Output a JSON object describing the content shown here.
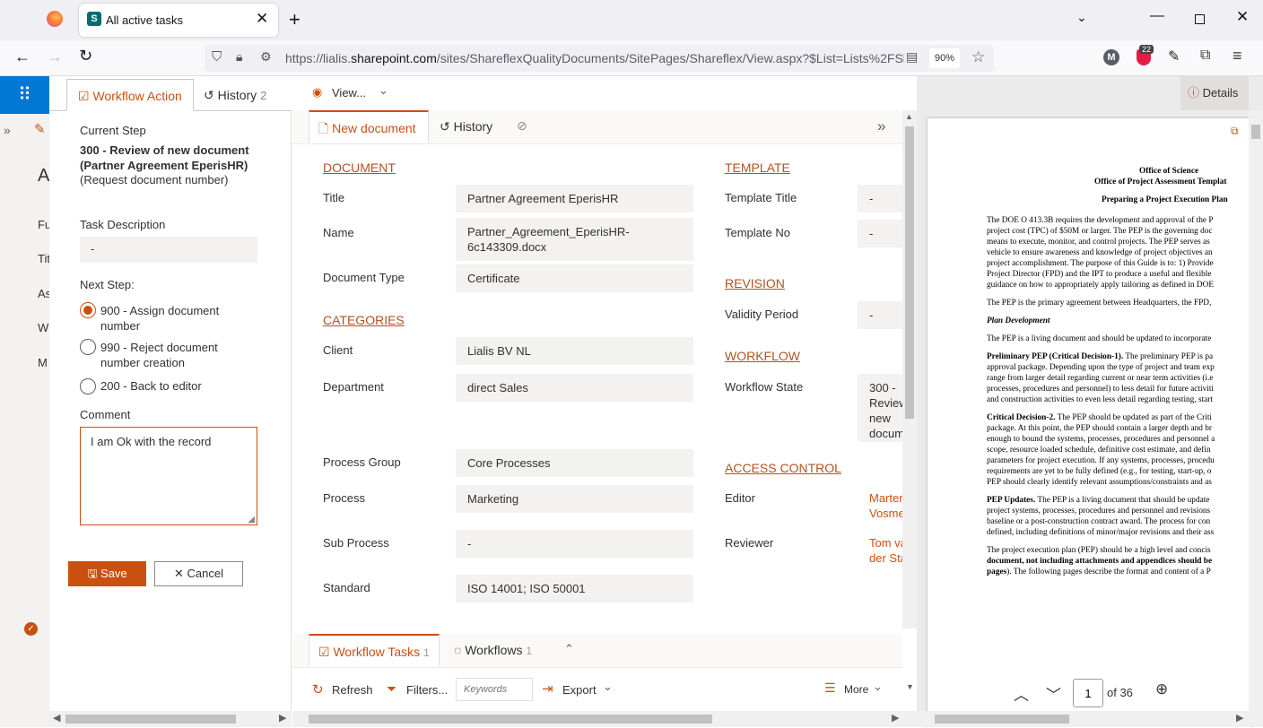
{
  "browser": {
    "tab_title": "All active tasks",
    "url_prefix": "https://lialis.",
    "url_domain": "sharepoint.com",
    "url_suffix": "/sites/ShareflexQualityDocuments/SitePages/Shareflex/View.aspx?$List=Lists%2FShar",
    "zoom": "90%",
    "ext_badge": "22",
    "profile_initial": "M"
  },
  "left_nav": {
    "letters": [
      "A",
      "Fu",
      "Tit",
      "As",
      "W",
      "M"
    ]
  },
  "workflow_panel": {
    "tab_action": "Workflow Action",
    "tab_history": "History",
    "history_count": "2",
    "current_step_label": "Current Step",
    "current_step_value": "300 - Review of new document (Partner Agreement EperisHR)",
    "current_step_sub": "(Request document number)",
    "task_desc_label": "Task Description",
    "task_desc_value": "-",
    "next_step_label": "Next Step:",
    "options": [
      {
        "label": "900 - Assign document number",
        "line1": "900 - Assign document",
        "line2": "number",
        "selected": true
      },
      {
        "label": "990 - Reject document number creation",
        "line1": "990 - Reject document",
        "line2": "number creation",
        "selected": false
      },
      {
        "label": "200 - Back to editor",
        "line1": "200 - Back to editor",
        "line2": "",
        "selected": false
      }
    ],
    "comment_label": "Comment",
    "comment_value": "I am Ok with the record",
    "save_label": "Save",
    "cancel_label": "Cancel"
  },
  "main": {
    "view_label": "View...",
    "details_label": "Details",
    "tab_new_document": "New document",
    "tab_history": "History",
    "sections": {
      "document": "DOCUMENT",
      "categories": "CATEGORIES",
      "template": "TEMPLATE",
      "revision": "REVISION",
      "workflow": "WORKFLOW",
      "access_control": "ACCESS CONTROL"
    },
    "fields": {
      "title_label": "Title",
      "title_value": "Partner Agreement EperisHR",
      "name_label": "Name",
      "name_value_1": "Partner_Agreement_EperisHR-",
      "name_value_2": "6c143309.docx",
      "doctype_label": "Document Type",
      "doctype_value": "Certificate",
      "client_label": "Client",
      "client_value": "Lialis BV NL",
      "department_label": "Department",
      "department_value": "direct Sales",
      "process_group_label": "Process Group",
      "process_group_value": "Core Processes",
      "process_label": "Process",
      "process_value": "Marketing",
      "sub_process_label": "Sub Process",
      "sub_process_value": "-",
      "standard_label": "Standard",
      "standard_value": "ISO 14001; ISO 50001",
      "template_title_label": "Template Title",
      "template_title_value": "-",
      "template_no_label": "Template No",
      "template_no_value": "-",
      "validity_label": "Validity Period",
      "validity_value": "-",
      "wf_state_label": "Workflow State",
      "wf_state_lines": [
        "300 -",
        "Review",
        "new",
        "docum"
      ],
      "editor_label": "Editor",
      "editor_lines": [
        "Marten",
        "Vosme"
      ],
      "reviewer_label": "Reviewer",
      "reviewer_lines": [
        "Tom va",
        "der Sta"
      ]
    },
    "bottom_tabs": {
      "workflow_tasks": "Workflow Tasks",
      "workflow_tasks_count": "1",
      "workflows": "Workflows",
      "workflows_count": "1"
    },
    "bottom_toolbar": {
      "refresh": "Refresh",
      "filters": "Filters...",
      "keywords_placeholder": "Keywords",
      "export": "Export",
      "more": "More"
    }
  },
  "preview": {
    "page_input": "1",
    "page_total": "of 36",
    "heading1": "Office of Science",
    "heading2": "Office of Project Assessment Templat",
    "heading3": "Preparing a Project Execution Plan",
    "para1": [
      "The DOE O 413.3B requires the development and approval of the P",
      "project cost (TPC) of $50M or larger.  The PEP is the governing doc",
      "means to execute, monitor, and control projects.  The PEP serves as",
      "vehicle to ensure awareness and knowledge of project objectives an",
      "project accomplishment.  The purpose of this Guide is to: 1) Provide",
      "Project Director (FPD) and the IPT to produce a useful and flexible",
      "guidance on how to appropriately apply tailoring as defined in DOE"
    ],
    "para2": "The PEP is the primary agreement between Headquarters, the FPD,",
    "para3": "Plan Development",
    "para4": "The PEP is a living  document and should be updated to incorporate",
    "para5_bold": "Preliminary PEP (Critical Decision-1).",
    "para5": [
      " The preliminary  PEP is pa",
      "approval package. Depending upon the type of project and team exp",
      "range from larger detail regarding current or near term activities (i.e",
      "processes, procedures and personnel) to less detail for future activiti",
      "and construction activities to even less detail regarding testing, start"
    ],
    "para6_bold": "Critical Decision-2.",
    "para6": [
      " The PEP should be updated as part of the Criti",
      "package. At this point, the PEP should contain a larger depth and br",
      "enough to bound the systems, processes, procedures and personnel a",
      "scope, resource loaded schedule, definitive cost estimate, and defin",
      "parameters for project execution.  If any systems, processes, procedu",
      "requirements are yet to be fully defined (e.g., for testing, start-up, o",
      "PEP should clearly identify relevant assumptions/constraints and as"
    ],
    "para7_bold": "PEP Updates.",
    "para7": [
      " The PEP is a living document that should be update",
      "project systems, processes, procedures and personnel and revisions",
      "baseline or a post-construction contract award.  The process for con",
      "defined, including definitions of minor/major revisions and their ass"
    ],
    "para8": [
      "The project execution plan (PEP) should be a high level and concis"
    ],
    "para8_bold": "document, not including attachments and appendices should be",
    "para8_tail_bold": "pages",
    "para8_tail": ").  The following pages describe the format and content of a P"
  }
}
